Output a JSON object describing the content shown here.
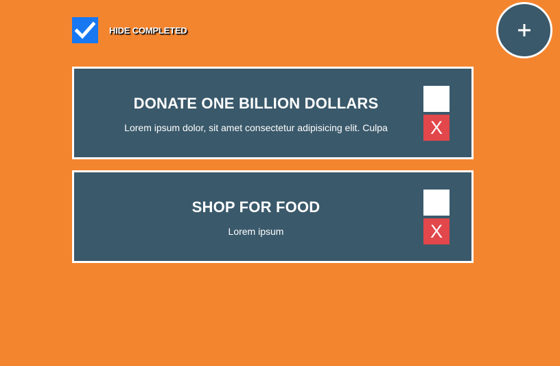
{
  "filter": {
    "hide_completed_label": "HIDE COMPLETED",
    "hide_completed_checked": true,
    "checkbox_color": "#1778F2"
  },
  "add_button": {
    "icon": "plus-icon"
  },
  "colors": {
    "background": "#F4852F",
    "card": "#3A596B",
    "card_border": "#FFFFFF",
    "delete": "#E2474B"
  },
  "todos": [
    {
      "title": "DONATE ONE BILLION DOLLARS",
      "description": "Lorem ipsum dolor, sit amet consectetur adipisicing elit. Culpa",
      "completed": false,
      "delete_label": "X"
    },
    {
      "title": "SHOP FOR FOOD",
      "description": "Lorem ipsum",
      "completed": false,
      "delete_label": "X"
    }
  ]
}
